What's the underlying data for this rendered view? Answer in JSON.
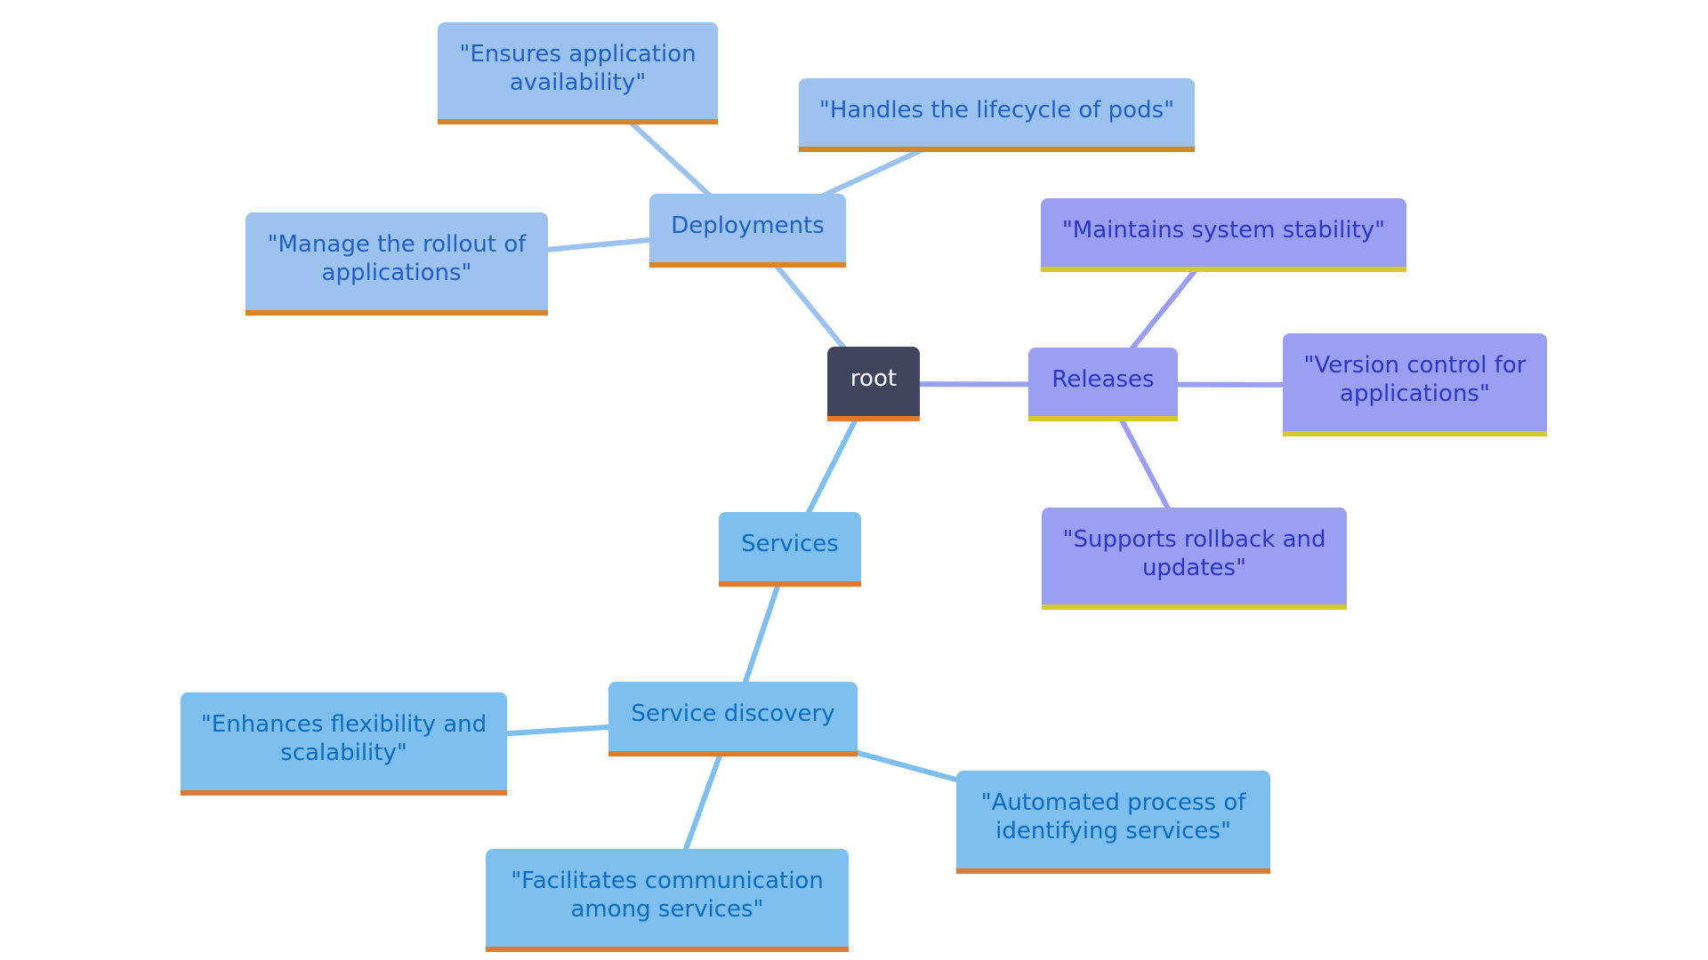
{
  "diagram": {
    "type": "mindmap",
    "root": {
      "id": "root",
      "label": "root"
    },
    "branches": [
      {
        "id": "deployments",
        "label": "Deployments",
        "color": {
          "bg": "#9cc3f0",
          "text": "#1f5fc4",
          "accent": "#d9832a",
          "edge": "#9cc3f0"
        },
        "children": [
          {
            "id": "ensures",
            "label": "\"Ensures application availability\""
          },
          {
            "id": "handles",
            "label": "\"Handles the lifecycle of pods\""
          },
          {
            "id": "manage",
            "label": "\"Manage the rollout of applications\""
          }
        ]
      },
      {
        "id": "releases",
        "label": "Releases",
        "color": {
          "bg": "#9b9ff2",
          "text": "#2d35c6",
          "accent": "#d4cb2a",
          "edge": "#9b9ff2"
        },
        "children": [
          {
            "id": "maintains",
            "label": "\"Maintains system stability\""
          },
          {
            "id": "version",
            "label": "\"Version control for applications\""
          },
          {
            "id": "supports",
            "label": "\"Supports rollback and updates\""
          }
        ]
      },
      {
        "id": "services",
        "label": "Services",
        "color": {
          "bg": "#7ebff0",
          "text": "#0a6cc0",
          "accent": "#e07a2e",
          "edge": "#7ebff0"
        },
        "children": [
          {
            "id": "discovery",
            "label": "Service discovery",
            "children": [
              {
                "id": "enhances",
                "label": "\"Enhances flexibility and scalability\""
              },
              {
                "id": "automated",
                "label": "\"Automated process of identifying services\""
              },
              {
                "id": "facilitates",
                "label": "\"Facilitates communication among services\""
              }
            ]
          }
        ]
      }
    ],
    "root_color": {
      "bg": "#40445c",
      "text": "#ffffff",
      "accent": "#e07a2e"
    }
  },
  "nodes": {
    "root": "root",
    "deployments": "Deployments",
    "ensures_l1": "\"Ensures application",
    "ensures_l2": "availability\"",
    "handles": "\"Handles the lifecycle of pods\"",
    "manage_l1": "\"Manage the rollout of",
    "manage_l2": "applications\"",
    "releases": "Releases",
    "maintains": "\"Maintains system stability\"",
    "version_l1": "\"Version control for",
    "version_l2": "applications\"",
    "supports_l1": "\"Supports rollback and",
    "supports_l2": "updates\"",
    "services": "Services",
    "discovery": "Service discovery",
    "enhances_l1": "\"Enhances flexibility and",
    "enhances_l2": "scalability\"",
    "automated_l1": "\"Automated process of",
    "automated_l2": "identifying services\"",
    "facilitates_l1": "\"Facilitates communication",
    "facilitates_l2": "among services\""
  }
}
